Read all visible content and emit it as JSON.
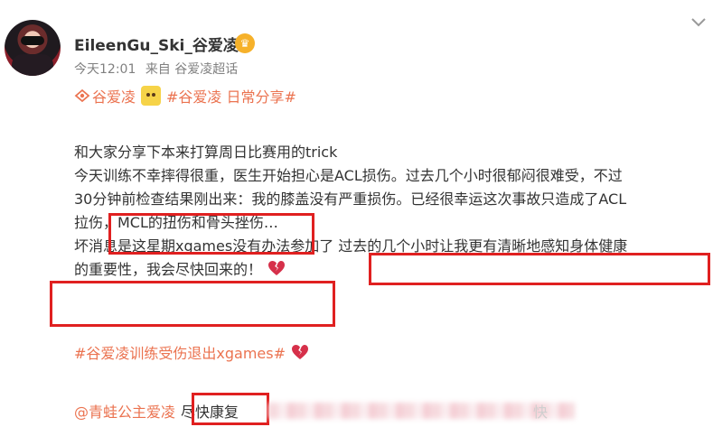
{
  "author": {
    "name": "EileenGu_Ski_谷爱凌",
    "badge_icon": "vip-crown-icon",
    "time": "今天12:01",
    "source": "来自 谷爱凌超话"
  },
  "tags": {
    "supertopic": "谷爱凌",
    "hashtag": "#谷爱凌 日常分享#"
  },
  "post": {
    "lines": [
      "和大家分享下本来打算周日比赛用的trick",
      "今天训练不幸摔得很重，医生开始担心是ACL损伤。过去几个小时很郁闷很难受，不过",
      "30分钟前检查结果刚出来：我的膝盖没有严重损伤。已经很幸运这次事故只造成了ACL",
      "拉伤，MCL的扭伤和骨头挫伤…",
      "坏消息是这星期xgames没有办法参加了 过去的几个小时让我更有清晰地感知身体健康",
      "的重要性，我会尽快回来的！"
    ]
  },
  "hashtag": "#谷爱凌训练受伤退出xgames#",
  "comment": {
    "mention": "@青蛙公主爱凌",
    "text": "尽快康复",
    "faint": "快"
  },
  "colors": {
    "accent": "#eb7350",
    "highlight_box": "#e02020",
    "text": "#333333",
    "meta": "#808080"
  }
}
